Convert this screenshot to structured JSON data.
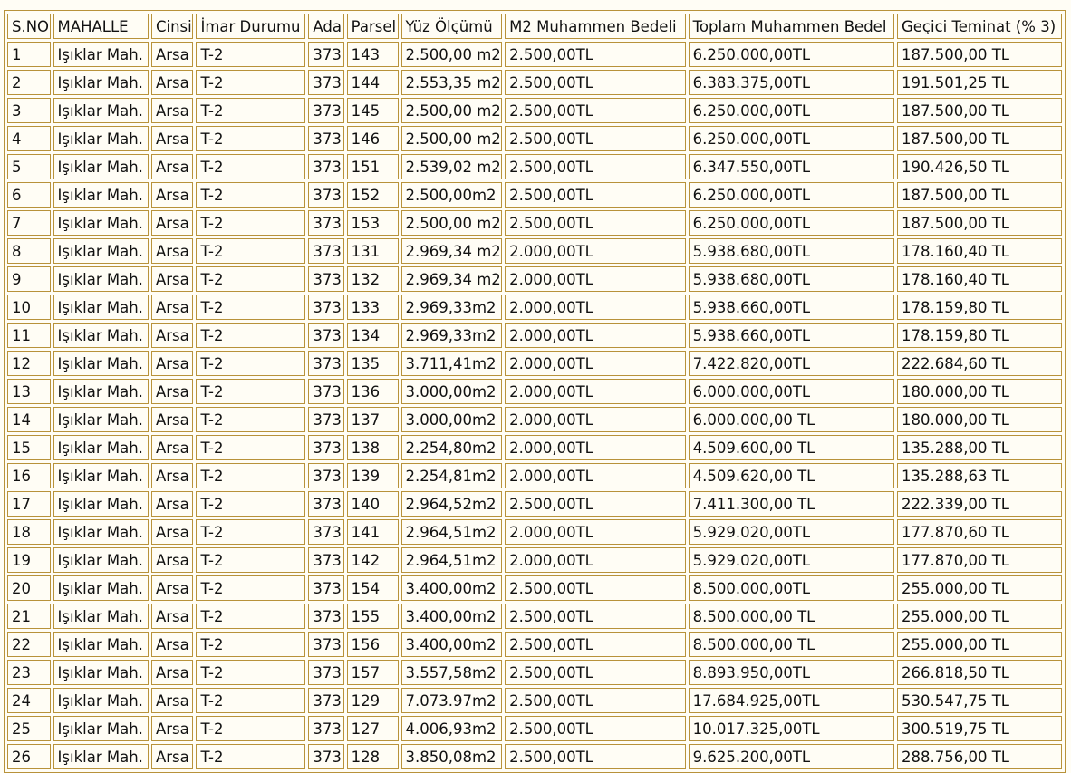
{
  "table": {
    "headers": [
      "S.NO",
      "MAHALLE",
      "Cinsi",
      "İmar Durumu",
      "Ada",
      "Parsel",
      "Yüz Ölçümü",
      "M2 Muhammen Bedeli",
      "Toplam Muhammen Bedel",
      "Geçici Teminat (% 3)"
    ],
    "rows": [
      [
        "1",
        "Işıklar Mah.",
        "Arsa",
        "T-2",
        "373",
        "143",
        "2.500,00 m2",
        "2.500,00TL",
        "6.250.000,00TL",
        "187.500,00 TL"
      ],
      [
        "2",
        "Işıklar Mah.",
        "Arsa",
        "T-2",
        "373",
        "144",
        "2.553,35 m2",
        "2.500,00TL",
        "6.383.375,00TL",
        "191.501,25 TL"
      ],
      [
        "3",
        "Işıklar Mah.",
        "Arsa",
        "T-2",
        "373",
        "145",
        "2.500,00 m2",
        "2.500,00TL",
        "6.250.000,00TL",
        "187.500,00 TL"
      ],
      [
        "4",
        "Işıklar Mah.",
        "Arsa",
        "T-2",
        "373",
        "146",
        "2.500,00 m2",
        "2.500,00TL",
        "6.250.000,00TL",
        "187.500,00 TL"
      ],
      [
        "5",
        "Işıklar Mah.",
        "Arsa",
        "T-2",
        "373",
        "151",
        "2.539,02 m2",
        "2.500,00TL",
        "6.347.550,00TL",
        "190.426,50 TL"
      ],
      [
        "6",
        "Işıklar Mah.",
        "Arsa",
        "T-2",
        "373",
        "152",
        "2.500,00m2",
        "2.500,00TL",
        "6.250.000,00TL",
        "187.500,00 TL"
      ],
      [
        "7",
        "Işıklar Mah.",
        "Arsa",
        "T-2",
        "373",
        "153",
        "2.500,00 m2",
        "2.500,00TL",
        "6.250.000,00TL",
        "187.500,00 TL"
      ],
      [
        "8",
        "Işıklar Mah.",
        "Arsa",
        "T-2",
        "373",
        "131",
        "2.969,34 m2",
        "2.000,00TL",
        "5.938.680,00TL",
        "178.160,40 TL"
      ],
      [
        "9",
        "Işıklar Mah.",
        "Arsa",
        "T-2",
        "373",
        "132",
        "2.969,34 m2",
        "2.000,00TL",
        "5.938.680,00TL",
        "178.160,40 TL"
      ],
      [
        "10",
        "Işıklar Mah.",
        "Arsa",
        "T-2",
        "373",
        "133",
        "2.969,33m2",
        "2.000,00TL",
        "5.938.660,00TL",
        "178.159,80 TL"
      ],
      [
        "11",
        "Işıklar Mah.",
        "Arsa",
        "T-2",
        "373",
        "134",
        "2.969,33m2",
        "2.000,00TL",
        "5.938.660,00TL",
        "178.159,80 TL"
      ],
      [
        "12",
        "Işıklar Mah.",
        "Arsa",
        "T-2",
        "373",
        "135",
        "3.711,41m2",
        "2.000,00TL",
        "7.422.820,00TL",
        "222.684,60 TL"
      ],
      [
        "13",
        "Işıklar Mah.",
        "Arsa",
        "T-2",
        "373",
        "136",
        "3.000,00m2",
        "2.000,00TL",
        "6.000.000,00TL",
        "180.000,00 TL"
      ],
      [
        "14",
        "Işıklar Mah.",
        "Arsa",
        "T-2",
        "373",
        "137",
        "3.000,00m2",
        "2.000,00TL",
        "6.000.000,00 TL",
        "180.000,00 TL"
      ],
      [
        "15",
        "Işıklar Mah.",
        "Arsa",
        "T-2",
        "373",
        "138",
        "2.254,80m2",
        "2.000,00TL",
        "4.509.600,00 TL",
        "135.288,00 TL"
      ],
      [
        "16",
        "Işıklar Mah.",
        "Arsa",
        "T-2",
        "373",
        "139",
        "2.254,81m2",
        "2.000,00TL",
        "4.509.620,00 TL",
        "135.288,63 TL"
      ],
      [
        "17",
        "Işıklar Mah.",
        "Arsa",
        "T-2",
        "373",
        "140",
        "2.964,52m2",
        "2.500,00TL",
        "7.411.300,00 TL",
        "222.339,00 TL"
      ],
      [
        "18",
        "Işıklar Mah.",
        "Arsa",
        "T-2",
        "373",
        "141",
        "2.964,51m2",
        "2.000,00TL",
        "5.929.020,00TL",
        "177.870,60 TL"
      ],
      [
        "19",
        "Işıklar Mah.",
        "Arsa",
        "T-2",
        "373",
        "142",
        "2.964,51m2",
        "2.000,00TL",
        "5.929.020,00TL",
        "177.870,00 TL"
      ],
      [
        "20",
        "Işıklar Mah.",
        "Arsa",
        "T-2",
        "373",
        "154",
        "3.400,00m2",
        "2.500,00TL",
        "8.500.000,00TL",
        "255.000,00 TL"
      ],
      [
        "21",
        "Işıklar Mah.",
        "Arsa",
        "T-2",
        "373",
        "155",
        "3.400,00m2",
        "2.500,00TL",
        "8.500.000,00 TL",
        "255.000,00 TL"
      ],
      [
        "22",
        "Işıklar Mah.",
        "Arsa",
        "T-2",
        "373",
        "156",
        "3.400,00m2",
        "2.500,00TL",
        "8.500.000,00 TL",
        "255.000,00 TL"
      ],
      [
        "23",
        "Işıklar Mah.",
        "Arsa",
        "T-2",
        "373",
        "157",
        "3.557,58m2",
        "2.500,00TL",
        "8.893.950,00TL",
        "266.818,50 TL"
      ],
      [
        "24",
        "Işıklar Mah.",
        "Arsa",
        "T-2",
        "373",
        "129",
        "7.073.97m2",
        "2.500,00TL",
        "17.684.925,00TL",
        "530.547,75 TL"
      ],
      [
        "25",
        "Işıklar Mah.",
        "Arsa",
        "T-2",
        "373",
        "127",
        "4.006,93m2",
        "2.500,00TL",
        "10.017.325,00TL",
        "300.519,75 TL"
      ],
      [
        "26",
        "Işıklar Mah.",
        "Arsa",
        "T-2",
        "373",
        "128",
        "3.850,08m2",
        "2.500,00TL",
        "9.625.200,00TL",
        "288.756,00 TL"
      ]
    ]
  },
  "colors": {
    "border": "#b8923a",
    "background": "#fffdf5",
    "text": "#111111"
  }
}
